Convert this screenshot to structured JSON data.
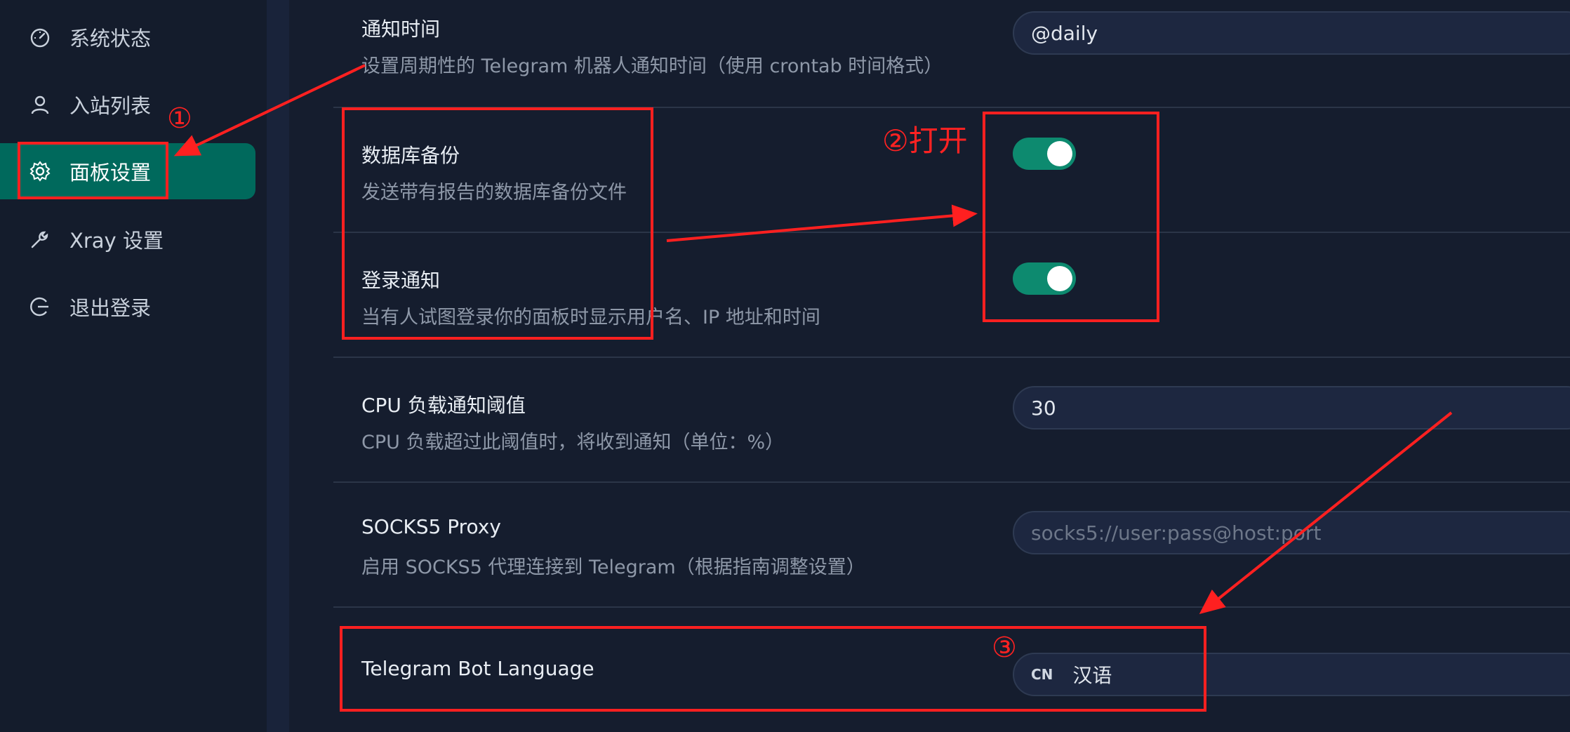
{
  "sidebar": {
    "items": [
      {
        "label": "系统状态",
        "icon": "dashboard-icon",
        "active": false
      },
      {
        "label": "入站列表",
        "icon": "user-icon",
        "active": false
      },
      {
        "label": "面板设置",
        "icon": "gear-icon",
        "active": true
      },
      {
        "label": "Xray 设置",
        "icon": "wrench-icon",
        "active": false
      },
      {
        "label": "退出登录",
        "icon": "logout-icon",
        "active": false
      }
    ]
  },
  "settings": {
    "notify_time": {
      "title": "通知时间",
      "desc": "设置周期性的 Telegram 机器人通知时间（使用 crontab 时间格式）",
      "value": "@daily"
    },
    "db_backup": {
      "title": "数据库备份",
      "desc": "发送带有报告的数据库备份文件",
      "enabled": true
    },
    "login_notify": {
      "title": "登录通知",
      "desc": "当有人试图登录你的面板时显示用户名、IP 地址和时间",
      "enabled": true
    },
    "cpu_threshold": {
      "title": "CPU 负载通知阈值",
      "desc": "CPU 负载超过此阈值时，将收到通知（单位：%）",
      "value": "30"
    },
    "socks5": {
      "title": "SOCKS5 Proxy",
      "desc": "启用 SOCKS5 代理连接到 Telegram（根据指南调整设置）",
      "placeholder": "socks5://user:pass@host:port"
    },
    "bot_language": {
      "title": "Telegram Bot Language",
      "flag": "CN",
      "value": "汉语"
    }
  },
  "annotations": {
    "step1": "①",
    "step2": "②打开",
    "step3": "③",
    "color": "#ff2020"
  },
  "colors": {
    "accent": "#00695c",
    "toggle_on": "#0d8a6f",
    "background": "#151d2e"
  }
}
